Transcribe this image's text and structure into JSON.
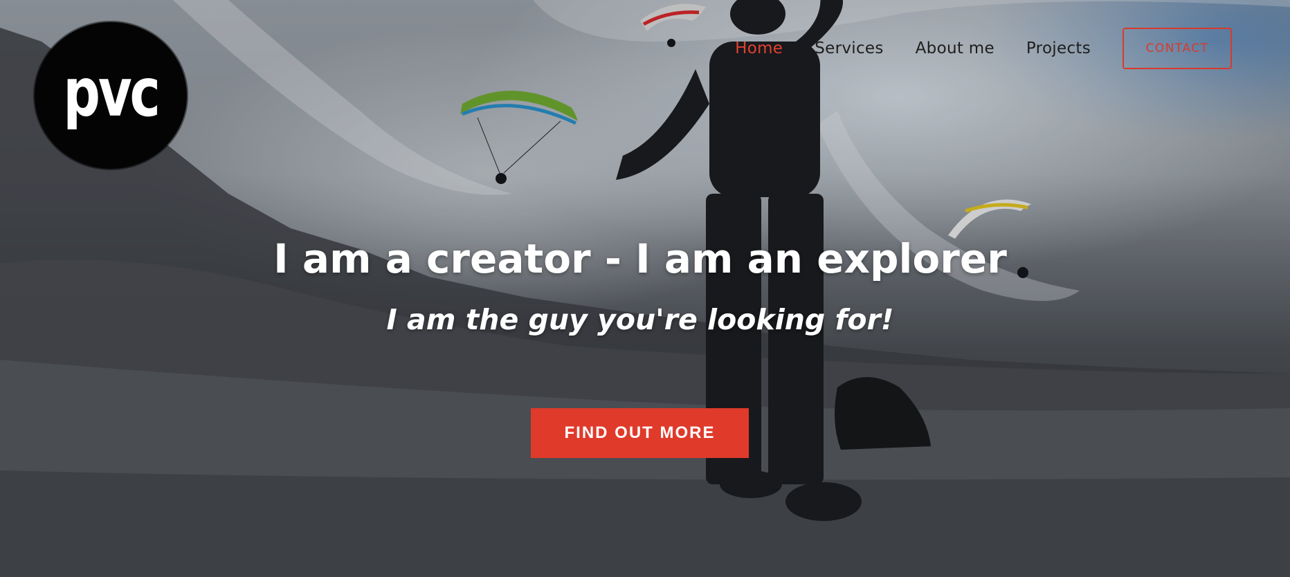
{
  "brand": {
    "logo_text": "pvc"
  },
  "nav": {
    "items": [
      {
        "label": "Home",
        "active": true
      },
      {
        "label": "Services",
        "active": false
      },
      {
        "label": "About me",
        "active": false
      },
      {
        "label": "Projects",
        "active": false
      }
    ],
    "contact_label": "CONTACT"
  },
  "hero": {
    "headline": "I am a creator - I am an explorer",
    "subline": "I am the guy you're looking for!",
    "cta_label": "FIND OUT MORE"
  },
  "colors": {
    "accent": "#e03a2b",
    "active_nav": "#e04030",
    "nav_text": "#1e1e1e",
    "logo_bg": "#040404"
  }
}
